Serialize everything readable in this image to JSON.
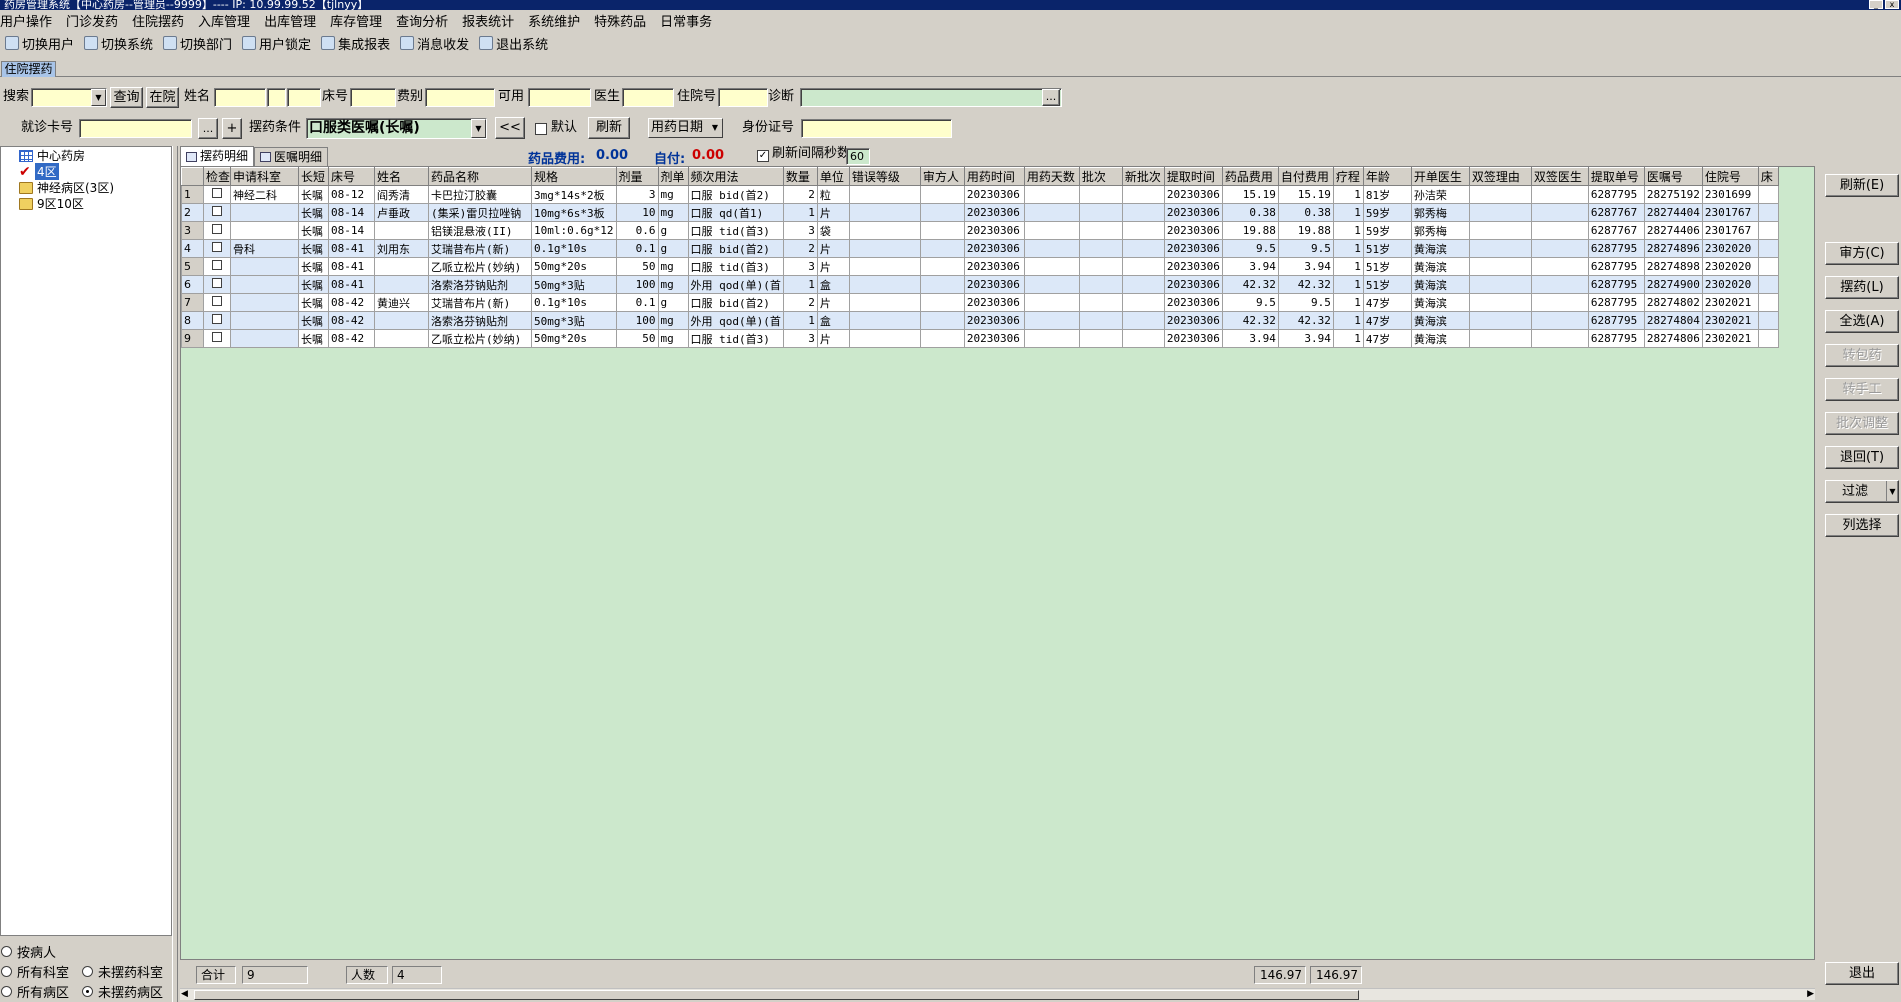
{
  "window": {
    "title": "药房管理系统【中心药房--管理员--9999】---- IP: 10.99.99.52【tjlnyy】"
  },
  "menu": [
    "用户操作",
    "门诊发药",
    "住院摆药",
    "入库管理",
    "出库管理",
    "库存管理",
    "查询分析",
    "报表统计",
    "系统维护",
    "特殊药品",
    "日常事务"
  ],
  "toolbar": [
    {
      "label": "切换用户",
      "icon": "switch-user-icon"
    },
    {
      "label": "切换系统",
      "icon": "switch-system-icon"
    },
    {
      "label": "切换部门",
      "icon": "switch-dept-icon"
    },
    {
      "label": "用户锁定",
      "icon": "lock-user-icon"
    },
    {
      "label": "集成报表",
      "icon": "report-icon"
    },
    {
      "label": "消息收发",
      "icon": "info-icon"
    },
    {
      "label": "退出系统",
      "icon": "exit-icon"
    }
  ],
  "tabs": {
    "active": "住院摆药"
  },
  "filter1": {
    "search_label": "搜索",
    "query_btn": "查询",
    "inhosp_btn": "在院",
    "name_label": "姓名",
    "bed_label": "床号",
    "feetype_label": "费别",
    "avail_label": "可用",
    "doctor_label": "医生",
    "hospno_label": "住院号",
    "diag_label": "诊断",
    "more_btn": "..."
  },
  "filter2": {
    "card_label": "就诊卡号",
    "more_btn": "...",
    "plus_btn": "+",
    "cond_label": "摆药条件",
    "cond_value": "口服类医嘱(长嘱)",
    "prev_btn": "<<",
    "default_label": "默认",
    "refresh_btn": "刷新",
    "date_combo": "用药日期",
    "idcard_label": "身份证号"
  },
  "tree": {
    "root": "中心药房",
    "items": [
      "4区",
      "神经病区(3区)",
      "9区10区"
    ]
  },
  "radios": {
    "by_patient": "按病人",
    "all_dept": "所有科室",
    "not_dept": "未摆药科室",
    "all_ward": "所有病区",
    "not_ward": "未摆药病区"
  },
  "subtabs": [
    "摆药明细",
    "医嘱明细"
  ],
  "fees": {
    "drug_fee_label": "药品费用:",
    "drug_fee": "0.00",
    "self_pay_label": "自付:",
    "self_pay": "0.00",
    "refresh_interval_label": "刷新间隔秒数",
    "refresh_interval": "60"
  },
  "grid": {
    "headers": [
      "检查",
      "申请科室",
      "长短",
      "床号",
      "姓名",
      "药品名称",
      "规格",
      "剂量",
      "剂单",
      "频次用法",
      "数量",
      "单位",
      "错误等级",
      "审方人",
      "用药时间",
      "用药天数",
      "批次",
      "新批次",
      "提取时间",
      "药品费用",
      "自付费用",
      "疗程",
      "年龄",
      "开单医生",
      "双签理由",
      "双签医生",
      "提取单号",
      "医嘱号",
      "住院号",
      "床"
    ],
    "rows": [
      {
        "n": "1",
        "dept": "神经二科",
        "type": "长嘱",
        "bed": "08-12",
        "name": "阎秀清",
        "drug": "卡巴拉汀胶囊",
        "spec": "3mg*14s*2板",
        "dose": "3",
        "du": "mg",
        "freq": "口服 bid(首2)",
        "qty": "2",
        "unit": "粒",
        "time": "20230306",
        "ext": "20230306",
        "fee": "15.19",
        "self": "15.19",
        "course": "1",
        "age": "81岁",
        "doc": "孙洁荣",
        "pick": "6287795",
        "order": "28275192",
        "hosp": "2301699"
      },
      {
        "n": "2",
        "dept": "",
        "type": "长嘱",
        "bed": "08-14",
        "name": "卢垂政",
        "drug": "(集采)雷贝拉唑钠",
        "spec": "10mg*6s*3板",
        "dose": "10",
        "du": "mg",
        "freq": "口服 qd(首1)",
        "qty": "1",
        "unit": "片",
        "time": "20230306",
        "ext": "20230306",
        "fee": "0.38",
        "self": "0.38",
        "course": "1",
        "age": "59岁",
        "doc": "郭秀梅",
        "pick": "6287767",
        "order": "28274404",
        "hosp": "2301767"
      },
      {
        "n": "3",
        "dept": "",
        "type": "长嘱",
        "bed": "08-14",
        "name": "",
        "drug": "铝镁混悬液(II)",
        "spec": "10ml:0.6g*12",
        "dose": "0.6",
        "du": "g",
        "freq": "口服 tid(首3)",
        "qty": "3",
        "unit": "袋",
        "time": "20230306",
        "ext": "20230306",
        "fee": "19.88",
        "self": "19.88",
        "course": "1",
        "age": "59岁",
        "doc": "郭秀梅",
        "pick": "6287767",
        "order": "28274406",
        "hosp": "2301767"
      },
      {
        "n": "4",
        "dept": "骨科",
        "type": "长嘱",
        "bed": "08-41",
        "name": "刘用东",
        "drug": "艾瑞昔布片(新)",
        "spec": "0.1g*10s",
        "dose": "0.1",
        "du": "g",
        "freq": "口服 bid(首2)",
        "qty": "2",
        "unit": "片",
        "time": "20230306",
        "ext": "20230306",
        "fee": "9.5",
        "self": "9.5",
        "course": "1",
        "age": "51岁",
        "doc": "黄海滨",
        "pick": "6287795",
        "order": "28274896",
        "hosp": "2302020"
      },
      {
        "n": "5",
        "dept": "",
        "type": "长嘱",
        "bed": "08-41",
        "name": "",
        "drug": "乙哌立松片(妙纳)",
        "spec": "50mg*20s",
        "dose": "50",
        "du": "mg",
        "freq": "口服 tid(首3)",
        "qty": "3",
        "unit": "片",
        "time": "20230306",
        "ext": "20230306",
        "fee": "3.94",
        "self": "3.94",
        "course": "1",
        "age": "51岁",
        "doc": "黄海滨",
        "pick": "6287795",
        "order": "28274898",
        "hosp": "2302020"
      },
      {
        "n": "6",
        "dept": "",
        "type": "长嘱",
        "bed": "08-41",
        "name": "",
        "drug": "洛索洛芬钠贴剂",
        "spec": "50mg*3贴",
        "dose": "100",
        "du": "mg",
        "freq": "外用 qod(单)(首",
        "qty": "1",
        "unit": "盒",
        "time": "20230306",
        "ext": "20230306",
        "fee": "42.32",
        "self": "42.32",
        "course": "1",
        "age": "51岁",
        "doc": "黄海滨",
        "pick": "6287795",
        "order": "28274900",
        "hosp": "2302020"
      },
      {
        "n": "7",
        "dept": "",
        "type": "长嘱",
        "bed": "08-42",
        "name": "黄迪兴",
        "drug": "艾瑞昔布片(新)",
        "spec": "0.1g*10s",
        "dose": "0.1",
        "du": "g",
        "freq": "口服 bid(首2)",
        "qty": "2",
        "unit": "片",
        "time": "20230306",
        "ext": "20230306",
        "fee": "9.5",
        "self": "9.5",
        "course": "1",
        "age": "47岁",
        "doc": "黄海滨",
        "pick": "6287795",
        "order": "28274802",
        "hosp": "2302021"
      },
      {
        "n": "8",
        "dept": "",
        "type": "长嘱",
        "bed": "08-42",
        "name": "",
        "drug": "洛索洛芬钠贴剂",
        "spec": "50mg*3贴",
        "dose": "100",
        "du": "mg",
        "freq": "外用 qod(单)(首",
        "qty": "1",
        "unit": "盒",
        "time": "20230306",
        "ext": "20230306",
        "fee": "42.32",
        "self": "42.32",
        "course": "1",
        "age": "47岁",
        "doc": "黄海滨",
        "pick": "6287795",
        "order": "28274804",
        "hosp": "2302021"
      },
      {
        "n": "9",
        "dept": "",
        "type": "长嘱",
        "bed": "08-42",
        "name": "",
        "drug": "乙哌立松片(妙纳)",
        "spec": "50mg*20s",
        "dose": "50",
        "du": "mg",
        "freq": "口服 tid(首3)",
        "qty": "3",
        "unit": "片",
        "time": "20230306",
        "ext": "20230306",
        "fee": "3.94",
        "self": "3.94",
        "course": "1",
        "age": "47岁",
        "doc": "黄海滨",
        "pick": "6287795",
        "order": "28274806",
        "hosp": "2302021"
      }
    ]
  },
  "footer": {
    "total_label": "合计",
    "total": "9",
    "people_label": "人数",
    "people": "4",
    "fee_sum": "146.97",
    "self_sum": "146.97"
  },
  "actions": {
    "refresh": "刷新(E)",
    "review": "审方(C)",
    "dispense": "摆药(L)",
    "select_all": "全选(A)",
    "to_pack": "转包药",
    "to_manual": "转手工",
    "batch_adjust": "批次调整",
    "return": "退回(T)",
    "filter": "过滤",
    "columns": "列选择",
    "exit": "退出"
  }
}
